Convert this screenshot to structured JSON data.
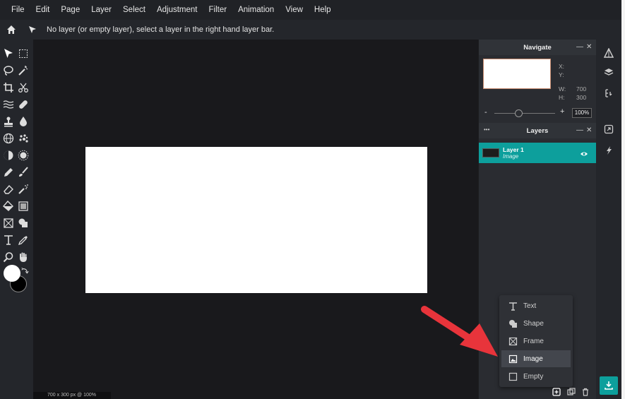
{
  "menu": [
    "File",
    "Edit",
    "Page",
    "Layer",
    "Select",
    "Adjustment",
    "Filter",
    "Animation",
    "View",
    "Help"
  ],
  "options_bar": {
    "home_icon": "home-icon",
    "tool_icon": "move-arrow-icon",
    "message": "No layer (or empty layer), select a layer in the right hand layer bar."
  },
  "navigate": {
    "title": "Navigate",
    "x_label": "X:",
    "y_label": "Y:",
    "w_label": "W:",
    "w_value": "700",
    "h_label": "H:",
    "h_value": "300",
    "zoom_minus": "-",
    "zoom_plus": "+",
    "zoom_value": "100%"
  },
  "layers": {
    "menu_dots": "•••",
    "title": "Layers",
    "items": [
      {
        "name": "Layer 1",
        "type": "Image"
      }
    ]
  },
  "add_menu": {
    "items": [
      {
        "label": "Text",
        "icon": "text-icon"
      },
      {
        "label": "Shape",
        "icon": "shape-icon"
      },
      {
        "label": "Frame",
        "icon": "frame-icon"
      },
      {
        "label": "Image",
        "icon": "image-icon"
      },
      {
        "label": "Empty",
        "icon": "empty-icon"
      }
    ],
    "highlighted": "Image"
  },
  "status": "700 x 300 px @ 100%",
  "colors": {
    "accent": "#0d9f9c",
    "background": "#19191c",
    "panel": "#2a2c31",
    "arrow": "#e8343b"
  }
}
